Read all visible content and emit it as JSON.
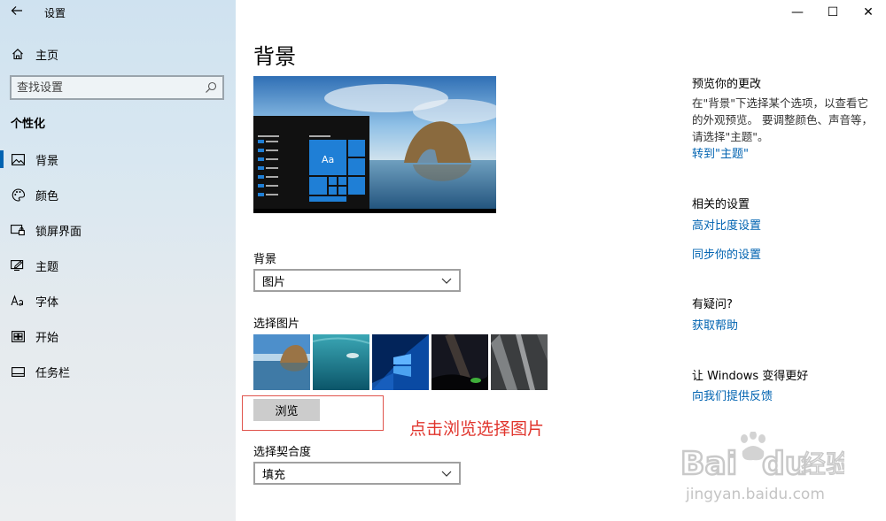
{
  "app": {
    "title": "设置",
    "back_icon": "back-arrow-icon"
  },
  "window_controls": {
    "minimize": "—",
    "maximize": "☐",
    "close": "✕"
  },
  "sidebar": {
    "home_label": "主页",
    "search_placeholder": "查找设置",
    "section_title": "个性化",
    "items": [
      {
        "label": "背景",
        "icon": "picture-icon",
        "active": true
      },
      {
        "label": "颜色",
        "icon": "palette-icon",
        "active": false
      },
      {
        "label": "锁屏界面",
        "icon": "lock-screen-icon",
        "active": false
      },
      {
        "label": "主题",
        "icon": "theme-icon",
        "active": false
      },
      {
        "label": "字体",
        "icon": "font-icon",
        "active": false
      },
      {
        "label": "开始",
        "icon": "start-icon",
        "active": false
      },
      {
        "label": "任务栏",
        "icon": "taskbar-icon",
        "active": false
      }
    ]
  },
  "main": {
    "page_title": "背景",
    "preview": {
      "tile_text": "Aa"
    },
    "background_label": "背景",
    "background_value": "图片",
    "choose_picture_label": "选择图片",
    "browse_label": "浏览",
    "annotation": "点击浏览选择图片",
    "fit_label": "选择契合度",
    "fit_value": "填充"
  },
  "right": {
    "preview_heading": "预览你的更改",
    "preview_desc": "在\"背景\"下选择某个选项，以查看它的外观预览。 要调整颜色、声音等，请选择\"主题\"。",
    "themes_link": "转到\"主题\"",
    "related_heading": "相关的设置",
    "high_contrast_link": "高对比度设置",
    "sync_link": "同步你的设置",
    "question_heading": "有疑问?",
    "help_link": "获取帮助",
    "better_heading": "让 Windows 变得更好",
    "feedback_link": "向我们提供反馈"
  },
  "watermark": {
    "brand": "Bai",
    "brand2": "du",
    "cn": "经验",
    "url": "jingyan.baidu.com"
  },
  "colors": {
    "accent": "#0063b1",
    "annotation": "#e0342c",
    "sidebar_bg": "#d8e7f1"
  }
}
